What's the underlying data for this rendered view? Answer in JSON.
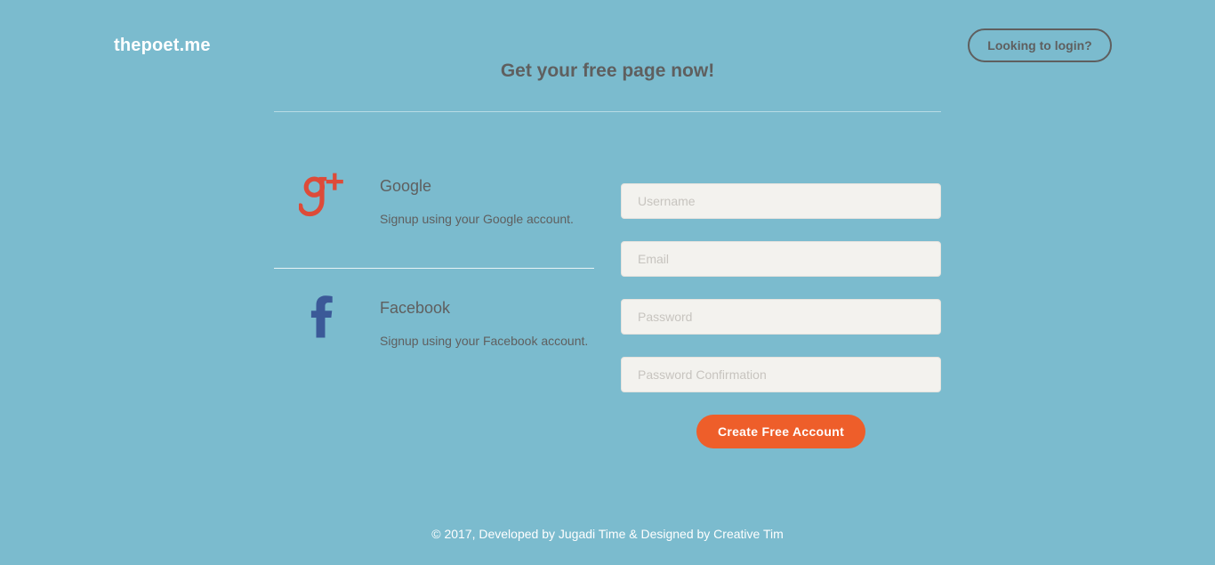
{
  "header": {
    "brand": "thepoet.me",
    "login_label": "Looking to login?"
  },
  "main": {
    "title": "Get your free page now!"
  },
  "social": [
    {
      "name": "Google",
      "description": "Signup using your Google account.",
      "icon": "google-plus-icon",
      "color": "#dd4b39"
    },
    {
      "name": "Facebook",
      "description": "Signup using your Facebook account.",
      "icon": "facebook-icon",
      "color": "#3b5998"
    }
  ],
  "form": {
    "username_placeholder": "Username",
    "email_placeholder": "Email",
    "password_placeholder": "Password",
    "password_confirmation_placeholder": "Password Confirmation",
    "submit_label": "Create Free Account"
  },
  "footer": {
    "text": "© 2017, Developed by Jugadi Time & Designed by Creative Tim"
  },
  "colors": {
    "background": "#7bbbce",
    "accent": "#ee5e2a",
    "google": "#dd4b39",
    "facebook": "#3b5998"
  }
}
